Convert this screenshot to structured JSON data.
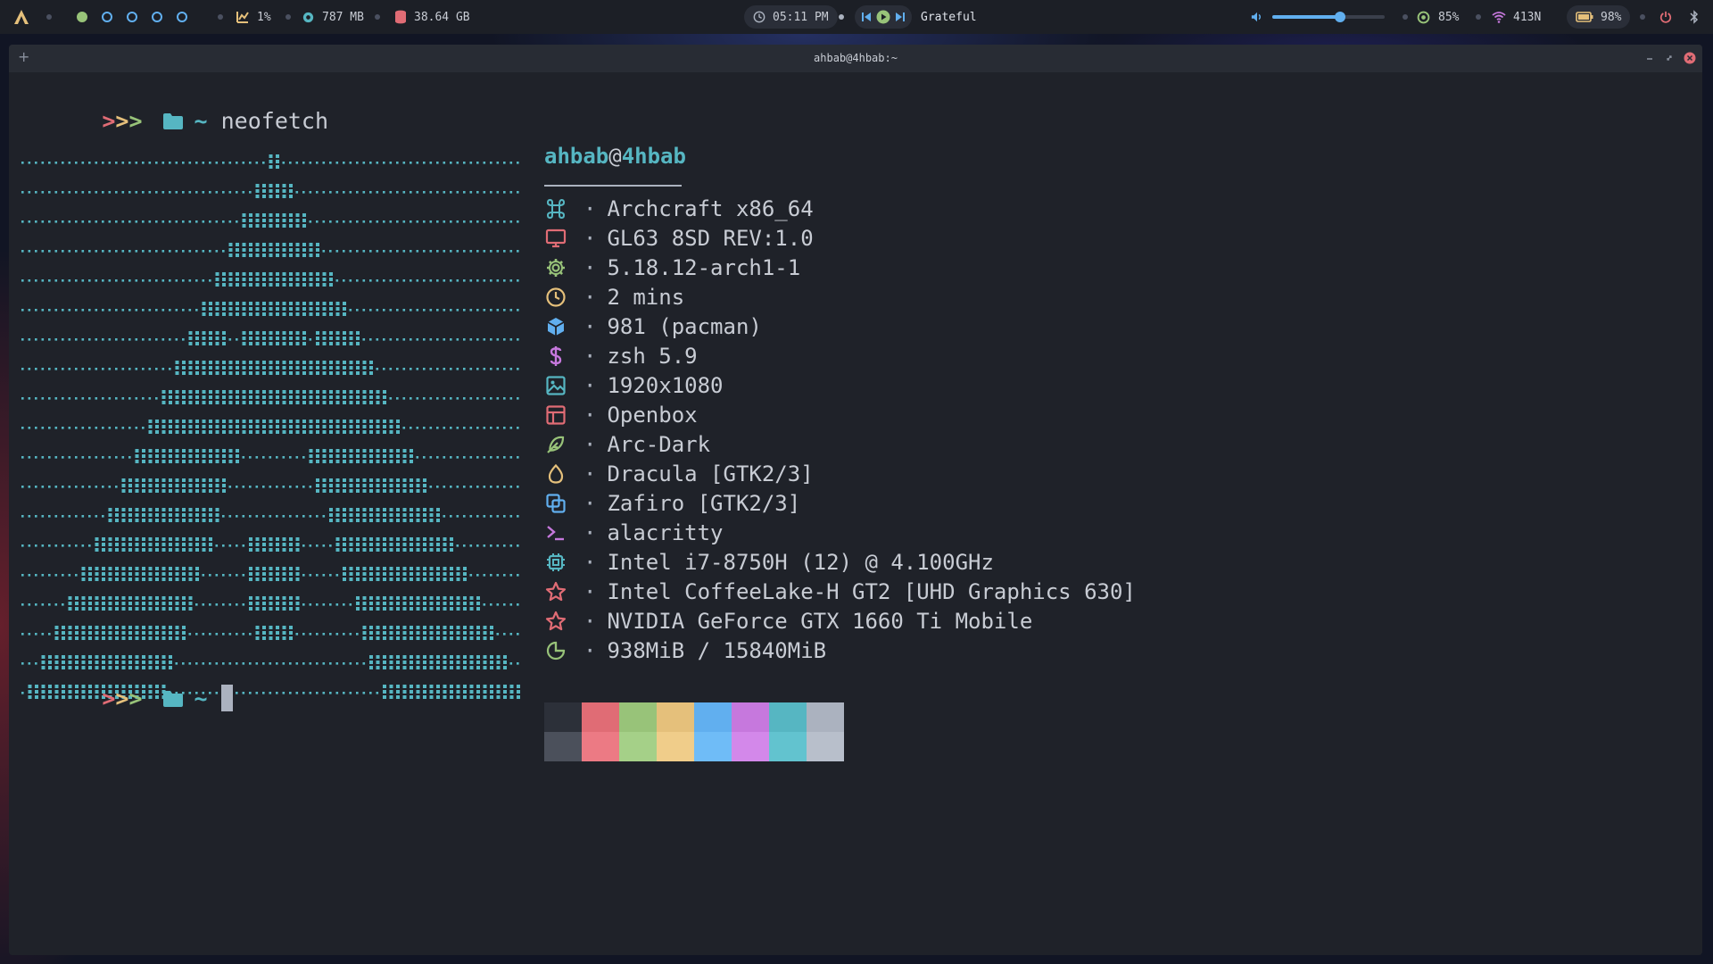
{
  "topbar": {
    "launcher_icon": "archcraft-logo-icon",
    "workspaces": [
      {
        "index": 1,
        "active": true
      },
      {
        "index": 2,
        "active": false
      },
      {
        "index": 3,
        "active": false
      },
      {
        "index": 4,
        "active": false
      },
      {
        "index": 5,
        "active": false
      }
    ],
    "cpu": {
      "icon": "chart-icon",
      "value": "1%"
    },
    "memory": {
      "icon": "memory-icon",
      "value": "787 MB"
    },
    "disk": {
      "icon": "disk-icon",
      "value": "38.64 GB"
    },
    "clock": {
      "icon": "clock-icon",
      "time": "05:11 PM"
    },
    "player": {
      "prev_icon": "previous-icon",
      "play_icon": "play-icon",
      "next_icon": "next-icon",
      "track": "Grateful"
    },
    "volume": {
      "icon": "volume-icon",
      "level_fraction": 0.6
    },
    "brightness": {
      "icon": "brightness-icon",
      "value": "85%"
    },
    "wifi": {
      "icon": "wifi-icon",
      "value": "413N"
    },
    "battery": {
      "icon": "battery-icon",
      "value": "98%"
    },
    "power_icon": "power-icon",
    "bluetooth_icon": "bluetooth-icon"
  },
  "window": {
    "title": "ahbab@4hbab:~",
    "new_tab_label": "+",
    "controls": [
      "minimize-icon",
      "maximize-icon",
      "close-icon"
    ]
  },
  "terminal": {
    "prompt_symbol": ">>>",
    "folder_icon": "folder-icon",
    "cwd": "~",
    "command": "neofetch",
    "second_prompt_cwd": "~"
  },
  "neofetch": {
    "user": "ahbab",
    "at": "@",
    "host": "4hbab",
    "separator": "·",
    "rows": [
      {
        "icon": "command-key-icon",
        "color": "#56b6c2",
        "value": "Archcraft x86_64"
      },
      {
        "icon": "monitor-icon",
        "color": "#e06c75",
        "value": "GL63 8SD REV:1.0"
      },
      {
        "icon": "gear-icon",
        "color": "#98c379",
        "value": "5.18.12-arch1-1"
      },
      {
        "icon": "clock-icon",
        "color": "#e5c07b",
        "value": "2 mins"
      },
      {
        "icon": "package-icon",
        "color": "#61afef",
        "value": "981 (pacman)"
      },
      {
        "icon": "dollar-icon",
        "color": "#c678dd",
        "value": "zsh 5.9"
      },
      {
        "icon": "image-icon",
        "color": "#56b6c2",
        "value": "1920x1080"
      },
      {
        "icon": "layout-icon",
        "color": "#e06c75",
        "value": "Openbox"
      },
      {
        "icon": "feather-icon",
        "color": "#98c379",
        "value": "Arc-Dark"
      },
      {
        "icon": "droplet-icon",
        "color": "#e5c07b",
        "value": "Dracula [GTK2/3]"
      },
      {
        "icon": "copy-icon",
        "color": "#61afef",
        "value": "Zafiro [GTK2/3]"
      },
      {
        "icon": "terminal-icon",
        "color": "#c678dd",
        "value": "alacritty"
      },
      {
        "icon": "cpu-icon",
        "color": "#56b6c2",
        "value": "Intel i7-8750H (12) @ 4.100GHz"
      },
      {
        "icon": "star-icon",
        "color": "#e06c75",
        "value": "Intel CoffeeLake-H GT2 [UHD Graphics 630]"
      },
      {
        "icon": "star-icon",
        "color": "#e06c75",
        "value": "NVIDIA GeForce GTX 1660 Ti Mobile"
      },
      {
        "icon": "pie-chart-icon",
        "color": "#98c379",
        "value": "938MiB / 15840MiB"
      }
    ],
    "palette": {
      "normal": [
        "#2c3039",
        "#e06c75",
        "#98c379",
        "#e5c07b",
        "#61afef",
        "#c678dd",
        "#56b6c2",
        "#abb2bf"
      ],
      "bright": [
        "#4b505b",
        "#ec7a84",
        "#a5d088",
        "#f0cd8a",
        "#6fbcf7",
        "#d388ea",
        "#62c3cf",
        "#b8bfcb"
      ]
    }
  },
  "colors": {
    "accent": "#56b6c2",
    "prompt_1": "#e06c75",
    "prompt_2": "#e5c07b",
    "prompt_3": "#98c379",
    "text": "#c8ccd4",
    "close": "#e06c75"
  }
}
